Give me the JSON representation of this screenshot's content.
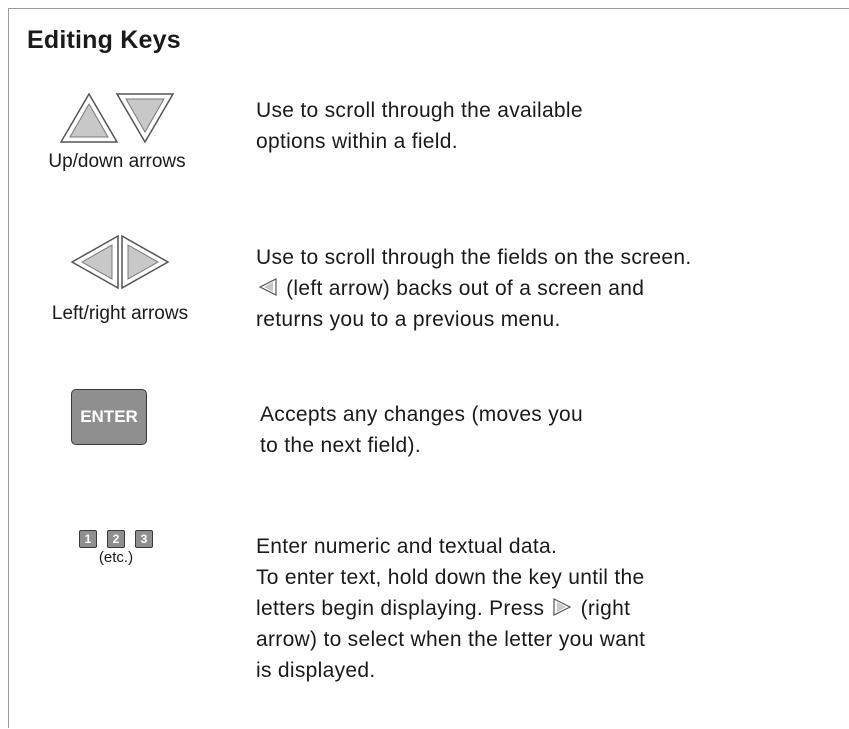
{
  "title": "Editing Keys",
  "rows": [
    {
      "icon": "up-down-arrows-icon",
      "caption": "Up/down arrows",
      "lines": [
        "Use to scroll through the available",
        "options within a field."
      ]
    },
    {
      "icon": "left-right-arrows-icon",
      "caption": "Left/right arrows",
      "lines": [
        "Use to scroll through the fields on the screen.",
        "(left arrow) backs out of a screen and",
        "returns you to a previous menu."
      ]
    },
    {
      "icon": "enter-key-icon",
      "key_label": "ENTER",
      "lines": [
        "Accepts any changes (moves you",
        "to the next field)."
      ]
    },
    {
      "icon": "numeric-keys-icon",
      "keys": [
        "1",
        "2",
        "3"
      ],
      "caption": "(etc.)",
      "lines": [
        "Enter numeric and textual data.",
        "To enter text, hold down the key until the",
        "letters begin displaying. Press",
        "(right",
        "arrow) to select when the letter you want",
        "is displayed."
      ]
    }
  ],
  "colors": {
    "key_gray": "#8f8f8f",
    "arrow_fill": "#c8c8c8",
    "frame": "#9a9a9a"
  }
}
